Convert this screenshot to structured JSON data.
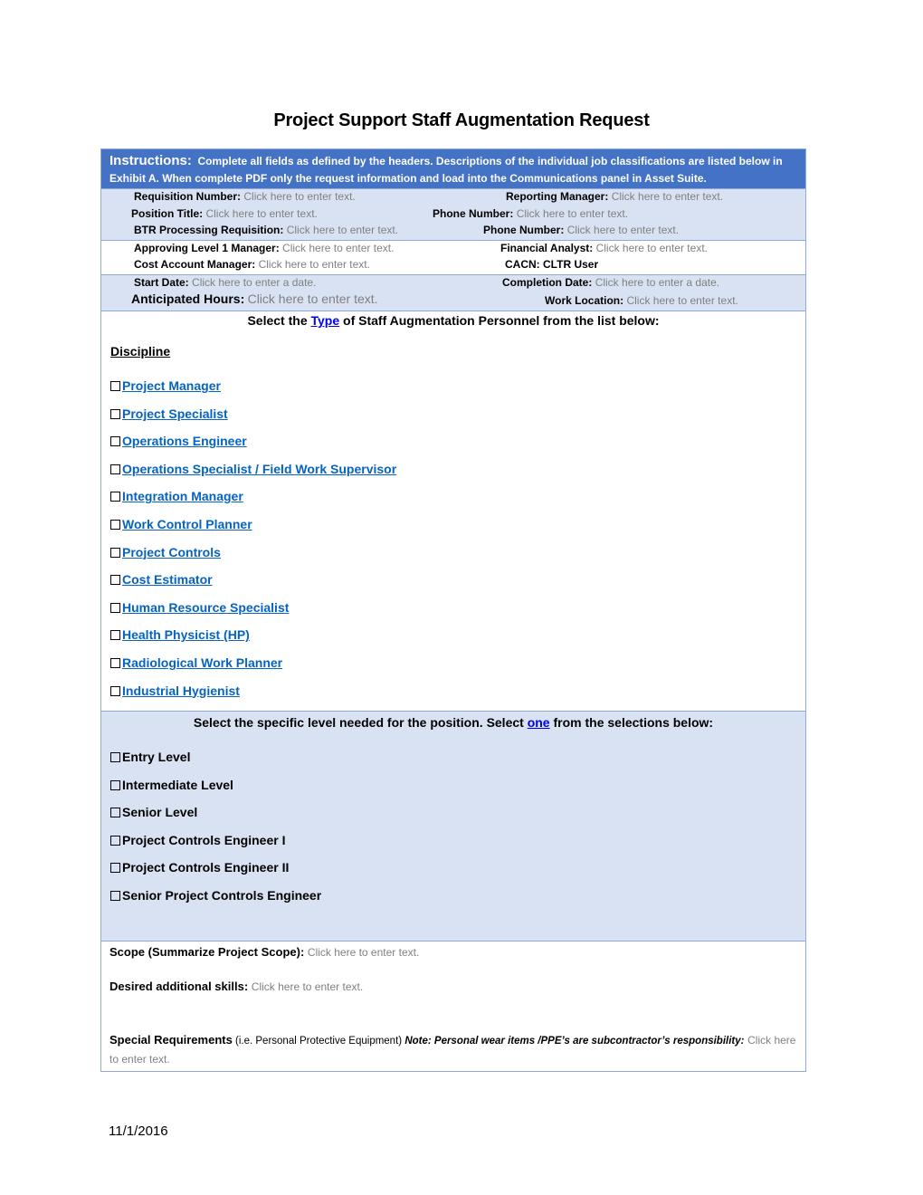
{
  "title": "Project Support Staff Augmentation Request",
  "instructions": {
    "lead": "Instructions:",
    "text": "Complete all fields as defined by the headers.  Descriptions of the individual job classifications are listed below in Exhibit A. When complete PDF only the request information and load into the Communications panel in Asset Suite."
  },
  "placeholder_text": "Click here to enter text.",
  "placeholder_date": "Click here to enter a date.",
  "fields": {
    "requisition_number": {
      "label": "Requisition Number:",
      "value": "Click here to enter text."
    },
    "reporting_manager": {
      "label": "Reporting Manager:",
      "value": "Click here to enter text."
    },
    "position_title": {
      "label": "Position Title:",
      "value": "Click here to enter text."
    },
    "phone_number_1": {
      "label": "Phone Number:",
      "value": "Click here to enter text."
    },
    "btr_processing_requisition": {
      "label": "BTR Processing Requisition:",
      "value": "Click here to enter text."
    },
    "phone_number_2": {
      "label": "Phone Number:",
      "value": "Click here to enter text."
    },
    "approving_level1_manager": {
      "label": "Approving Level 1 Manager:",
      "value": "Click here to enter text."
    },
    "financial_analyst": {
      "label": "Financial Analyst:",
      "value": "Click here to enter text."
    },
    "cost_account_manager": {
      "label": "Cost Account Manager:",
      "value": "Click here to enter text."
    },
    "cacn": {
      "label": "CACN:",
      "value": "CLTR User"
    },
    "start_date": {
      "label": "Start Date:",
      "value": "Click here to enter a date."
    },
    "completion_date": {
      "label": "Completion Date:",
      "value": "Click here to enter a date."
    },
    "anticipated_hours": {
      "label": "Anticipated Hours:",
      "value": "Click here to enter text."
    },
    "work_location": {
      "label": "Work Location:",
      "value": "Click here to enter text."
    }
  },
  "type_section": {
    "prefix": "Select the ",
    "link": "Type",
    "suffix": " of Staff Augmentation Personnel from the list below:",
    "discipline_heading": "Discipline",
    "disciplines": [
      {
        "label": "Project Manager",
        "checked": false
      },
      {
        "label": "Project Specialist",
        "checked": false
      },
      {
        "label": "Operations Engineer",
        "checked": false
      },
      {
        "label": "Operations Specialist / Field Work Supervisor",
        "checked": false
      },
      {
        "label": "Integration Manager",
        "checked": false
      },
      {
        "label": "Work Control Planner",
        "checked": false
      },
      {
        "label": "Project Controls",
        "checked": false
      },
      {
        "label": "Cost Estimator",
        "checked": false
      },
      {
        "label": "Human Resource Specialist",
        "checked": false
      },
      {
        "label": "Health Physicist (HP)",
        "checked": false
      },
      {
        "label": "Radiological Work Planner",
        "checked": false
      },
      {
        "label": "Industrial Hygienist",
        "checked": false
      }
    ]
  },
  "level_section": {
    "prefix": "Select the specific level needed for the position. Select ",
    "link": "one",
    "suffix": " from the selections below:",
    "levels": [
      {
        "label": "Entry Level",
        "checked": false
      },
      {
        "label": "Intermediate Level",
        "checked": false
      },
      {
        "label": "Senior Level",
        "checked": false
      },
      {
        "label": "Project Controls Engineer I",
        "checked": false
      },
      {
        "label": "Project Controls Engineer II",
        "checked": false
      },
      {
        "label": "Senior Project Controls Engineer",
        "checked": false
      }
    ]
  },
  "scope": {
    "label": "Scope (Summarize Project Scope):",
    "value": "Click here to enter text."
  },
  "skills": {
    "label": "Desired additional skills:",
    "value": "Click here to enter text."
  },
  "special": {
    "label": "Special Requirements",
    "paren": " (i.e. Personal Protective Equipment) ",
    "note": "Note: Personal wear items /PPE’s are subcontractor’s responsibility:",
    "value": "Click here to enter text."
  },
  "footer_date": "11/1/2016",
  "colors": {
    "header_blue": "#4472c4",
    "band_blue": "#d9e2f3",
    "border": "#8eaadb",
    "link_blue": "#0563c1",
    "placeholder_gray": "#808080"
  }
}
